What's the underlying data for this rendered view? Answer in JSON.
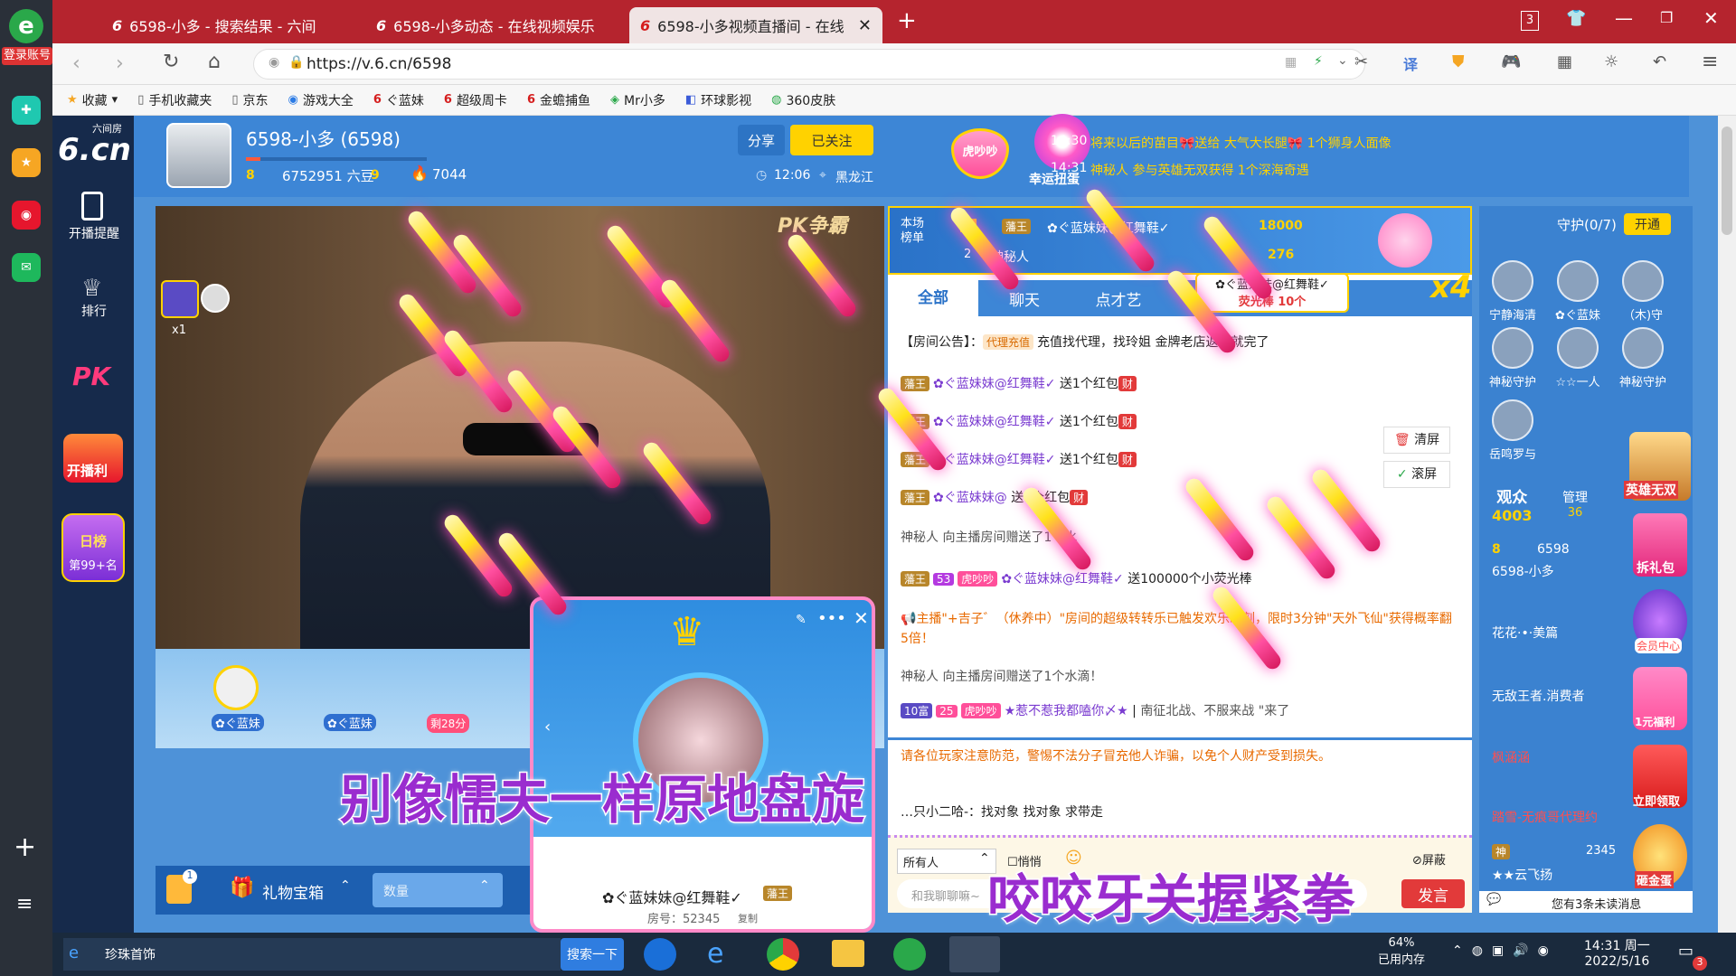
{
  "left_rail": {
    "login_label": "登录账号",
    "icons": [
      "browser-logo-icon",
      "plane-app-icon",
      "star-app-icon",
      "weibo-icon",
      "mail-icon"
    ],
    "bottom_icons": [
      "plus-icon",
      "list-icon"
    ]
  },
  "tabs": [
    {
      "title": "6598-小多 - 搜索结果 - 六间",
      "active": false
    },
    {
      "title": "6598-小多动态 - 在线视频娱乐",
      "active": false
    },
    {
      "title": "6598-小多视频直播间 - 在线",
      "active": true
    }
  ],
  "tab_new": "+",
  "window_count": "3",
  "address": {
    "url": "https://v.6.cn/6598"
  },
  "nav": {
    "translate": "译"
  },
  "bookmarks": [
    "收藏",
    "手机收藏夹",
    "京东",
    "游戏大全",
    "ぐ蓝妹",
    "超级周卡",
    "金蟾捕鱼",
    "Mr小多",
    "环球影视",
    "360皮肤"
  ],
  "site_nav": {
    "logo": "6.cn",
    "logo_top": "六间房",
    "items": [
      "开播提醒",
      "排行"
    ],
    "pk": "PK",
    "promo": "开播利",
    "daily": {
      "title": "日榜",
      "rank": "第99+名"
    }
  },
  "streamer": {
    "name": "6598-小多 (6598)",
    "level": "8",
    "beans": "6752951 六豆",
    "vip": "9",
    "fire": "7044",
    "share": "分享",
    "follow": "已关注",
    "time": "12:06",
    "location": "黑龙江",
    "badge_text": "虎吵吵",
    "lucky": "幸运扭蛋"
  },
  "notices": [
    {
      "time": "14:30",
      "text": "将来以后的苗目🎀送给 大气大长腿🎀 1个狮身人面像"
    },
    {
      "time": "14:31",
      "text": "神秘人 参与英雄无双获得 1个深海奇遇"
    }
  ],
  "video": {
    "pk_label": "PK争霸",
    "count": "x1",
    "user1": "✿ぐ蓝妹",
    "user2": "✿ぐ蓝妹",
    "remaining": "剩28分",
    "subtitle_top": "别像懦夫一样原地盘旋",
    "subtitle_bottom": "咬咬牙关握紧拳"
  },
  "popup": {
    "name": "✿ぐ蓝妹妹@红舞鞋✓",
    "badge": "藩王",
    "room": "房号：52345",
    "copy": "复制"
  },
  "controls": {
    "gift_count": "1",
    "gift_box": "礼物宝箱",
    "qty_placeholder": "数量"
  },
  "chat": {
    "rank_title": "本场榜单",
    "rank1": {
      "no": "1",
      "badge": "藩王",
      "name": "✿ぐ蓝妹妹@红舞鞋✓",
      "score": "18000"
    },
    "rank2": {
      "no": "2",
      "name": "神秘人",
      "score": "276"
    },
    "combo_user": "✿ぐ蓝妹妹@红舞鞋✓",
    "combo_gift": "荧光棒 10个",
    "combo_x": "x4",
    "tabs": [
      "全部",
      "聊天",
      "点才艺"
    ],
    "announcement_label": "【房间公告】：",
    "agent_tag": "代理充值",
    "announcement": "充值找代理，找玲姐 金牌老店返你就完了",
    "messages": [
      {
        "badge": "藩王",
        "user": "✿ぐ蓝妹妹@红舞鞋✓",
        "text": "送1个红包",
        "tag": "财"
      },
      {
        "badge": "藩王",
        "user": "✿ぐ蓝妹妹@红舞鞋✓",
        "text": "送1个红包",
        "tag": "财"
      },
      {
        "badge": "藩王",
        "user": "✿ぐ蓝妹妹@红舞鞋✓",
        "text": "送1个红包",
        "tag": "财"
      },
      {
        "badge": "藩王",
        "user": "✿ぐ蓝妹妹@",
        "text": "送1个红包",
        "tag": "财"
      }
    ],
    "sys1": "神秘人 向主播房间赠送了1个水",
    "gift_msg": {
      "badge": "藩王",
      "lv": "53",
      "tag": "虎吵吵",
      "user": "✿ぐ蓝妹妹@红舞鞋✓",
      "text": "送100000个小荧光棒"
    },
    "host_msg": "主播\"+吉子゛（休养中）\"房间的超级转转乐已触发欢乐时刻，限时3分钟\"天外飞仙\"获得概率翻5倍！",
    "sys2": "神秘人 向主播房间赠送了1个水滴！",
    "rich_msg": {
      "lv": "10富",
      "lv2": "25",
      "tag": "虎吵吵",
      "user": "★惹不惹我都嗑你〆★",
      "text": "南征北战、不服来战 \"来了"
    },
    "warning": "请各位玩家注意防范，警惕不法分子冒充他人诈骗，以免个人财产受到损失。",
    "partial": "…只小二哈-：找对象 找对象 求带走",
    "clear": "清屏",
    "scroll": "滚屏",
    "audience": "所有人",
    "whisper": "悄悄",
    "block": "屏蔽",
    "input_placeholder": "和我聊聊嘛~",
    "send": "发言"
  },
  "guard": {
    "title": "守护(0/7)",
    "open": "开通",
    "items": [
      "宁静海清",
      "✿ぐ蓝妹",
      "（木)守",
      "神秘守护",
      "☆☆一人",
      "神秘守护",
      "岳鸣罗与"
    ],
    "audience_label": "观众",
    "audience_count": "4003",
    "manage_label": "管理",
    "manage_count": "36",
    "self_level": "8",
    "self_score": "6598",
    "self_name": "6598-小多",
    "list": [
      "花花·•·美篇",
      "无敌王者.消费者",
      "枫涵涵",
      "踏雪-无痕哥代理约",
      "★★云飞扬"
    ],
    "list_score": "2345",
    "hero": "英雄无双",
    "gift_pack": "拆礼包",
    "member": "会员中心",
    "welfare": "1元福利",
    "receive": "立即领取",
    "golden_egg": "砸金蛋",
    "unread": "您有3条未读消息",
    "tag_god": "神"
  },
  "taskbar": {
    "task1": "珍珠首饰",
    "search": "搜索一下",
    "mem_pct": "64%",
    "mem_label": "已用内存",
    "time": "14:31 周一",
    "date": "2022/5/16",
    "notify": "3"
  },
  "colors": {
    "tabbar": "#b5242e",
    "accent": "#3d86d6",
    "gold": "#ffd200",
    "send": "#e23a3a"
  }
}
